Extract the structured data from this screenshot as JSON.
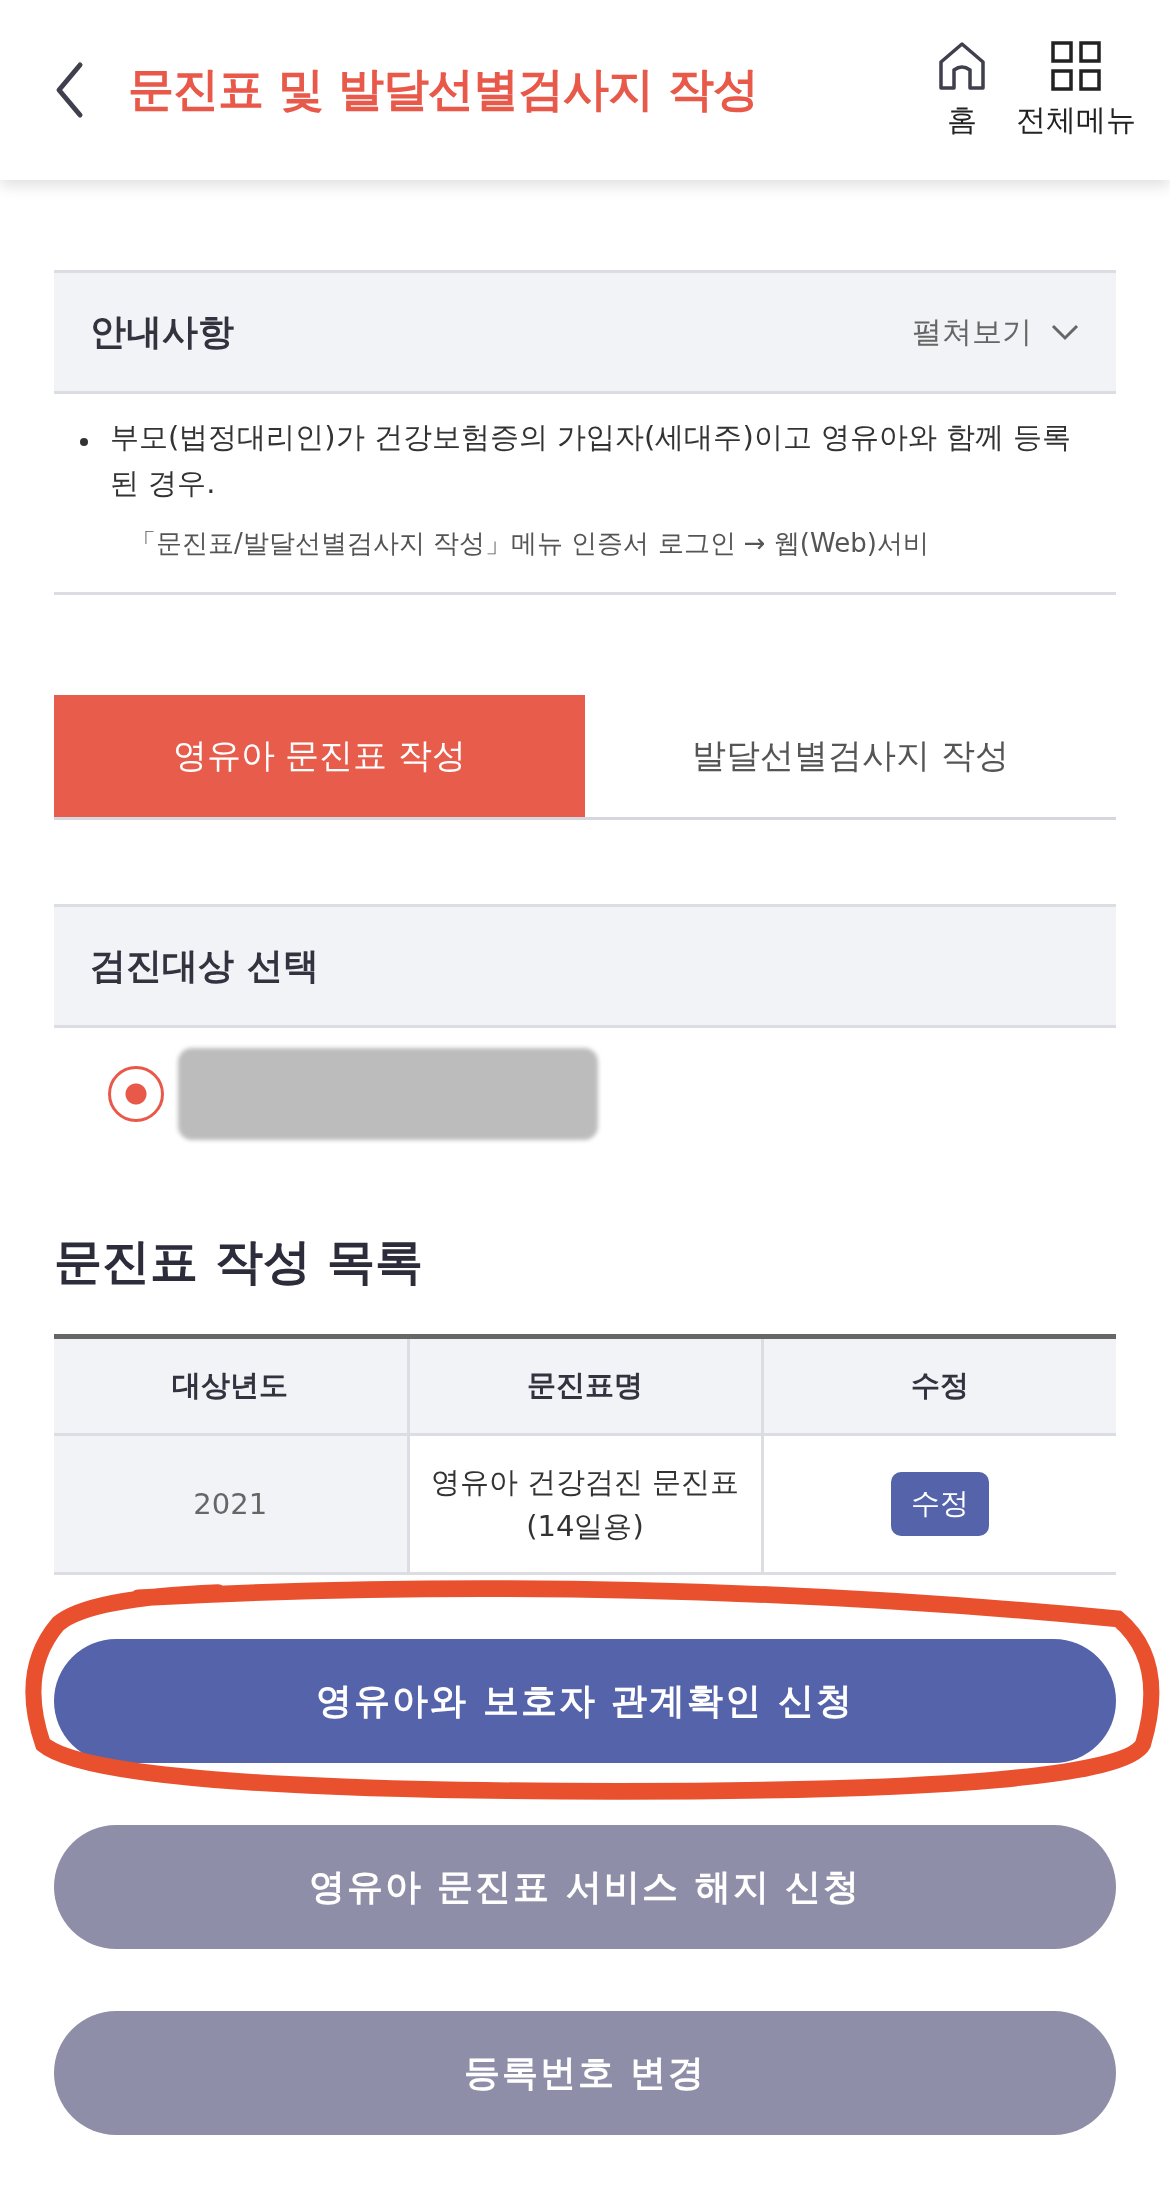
{
  "header": {
    "title": "문진표 및 발달선별검사지 작성",
    "actions": [
      {
        "kind": "home",
        "label": "홈"
      },
      {
        "kind": "menu",
        "label": "전체메뉴"
      }
    ]
  },
  "notice": {
    "title": "안내사항",
    "toggle": "펼쳐보기",
    "expanded": false,
    "items": [
      "부모(법정대리인)가 건강보험증의 가입자(세대주)이고 영유아와 함께 등록된 경우.",
      "「문진표/발달선별검사지 작성」메뉴 인증서 로그인 → 웹(Web)서비"
    ]
  },
  "tabs": [
    {
      "label": "영유아 문진표 작성",
      "selected": true
    },
    {
      "label": "발달선별검사지 작성",
      "selected": false
    }
  ],
  "target": {
    "title": "검진대상 선택",
    "options": [
      {
        "redacted": true,
        "selected": true
      }
    ]
  },
  "list": {
    "title": "문진표 작성 목록",
    "columns": [
      "대상년도",
      "문진표명",
      "수정"
    ],
    "rows": [
      {
        "year": "2021",
        "name": "영유아 건강검진 문진표(14일용)",
        "action": "수정"
      }
    ]
  },
  "buttons": [
    {
      "label": "영유아와 보호자 관계확인 신청",
      "kind": "primary",
      "highlighted": true
    },
    {
      "label": "영유아 문진표 서비스 해지 신청",
      "kind": "secondary",
      "highlighted": false
    },
    {
      "label": "등록번호 변경",
      "kind": "secondary",
      "highlighted": false
    }
  ]
}
